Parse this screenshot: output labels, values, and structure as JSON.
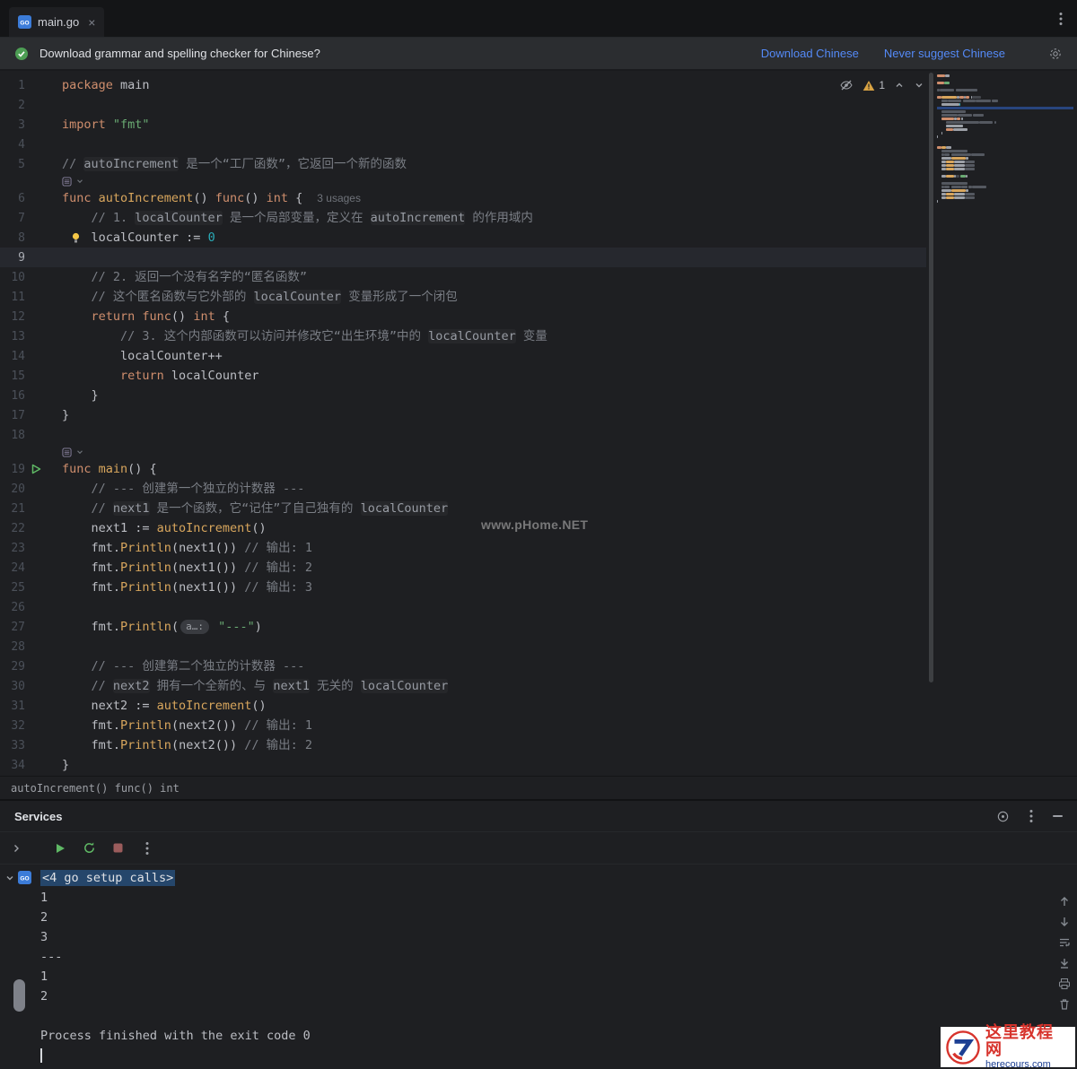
{
  "tab": {
    "label": "main.go",
    "close": "×"
  },
  "banner": {
    "text": "Download grammar and spelling checker for Chinese?",
    "actions": [
      {
        "label": "Download Chinese"
      },
      {
        "label": "Never suggest Chinese"
      }
    ]
  },
  "editor": {
    "inspection_warning_count": "1",
    "rows": [
      {
        "n": 1,
        "segs": [
          [
            "kw",
            "package "
          ],
          [
            "pl",
            "main"
          ]
        ]
      },
      {
        "n": 2,
        "segs": []
      },
      {
        "n": 3,
        "segs": [
          [
            "kw",
            "import "
          ],
          [
            "str",
            "\"fmt\""
          ]
        ]
      },
      {
        "n": 4,
        "segs": []
      },
      {
        "n": 5,
        "segs": [
          [
            "cmt",
            "// "
          ],
          [
            "cmtc",
            "autoIncrement"
          ],
          [
            "cmt",
            " 是一个“工厂函数”，它返回一个新的函数"
          ]
        ]
      },
      {
        "hint": true
      },
      {
        "n": 6,
        "segs": [
          [
            "kw",
            "func "
          ],
          [
            "fn",
            "autoIncrement"
          ],
          [
            "pl",
            "() "
          ],
          [
            "kw",
            "func"
          ],
          [
            "pl",
            "() "
          ],
          [
            "kw",
            "int"
          ],
          [
            "pl",
            " {"
          ],
          [
            "usages",
            "3 usages"
          ]
        ]
      },
      {
        "n": 7,
        "segs": [
          [
            "cmt",
            "    // 1. "
          ],
          [
            "cmtc",
            "localCounter"
          ],
          [
            "cmt",
            " 是一个局部变量，定义在 "
          ],
          [
            "cmtc",
            "autoIncrement"
          ],
          [
            "cmt",
            " 的作用域内"
          ]
        ]
      },
      {
        "n": 8,
        "bulb": true,
        "segs": [
          [
            "pl",
            "    localCounter := "
          ],
          [
            "num",
            "0"
          ]
        ]
      },
      {
        "n": 9,
        "current": true,
        "segs": []
      },
      {
        "n": 10,
        "segs": [
          [
            "cmt",
            "    // 2. 返回一个没有名字的“匿名函数”"
          ]
        ]
      },
      {
        "n": 11,
        "segs": [
          [
            "cmt",
            "    // 这个匿名函数与它外部的 "
          ],
          [
            "cmtc",
            "localCounter"
          ],
          [
            "cmt",
            " 变量形成了一个闭包"
          ]
        ]
      },
      {
        "n": 12,
        "segs": [
          [
            "kw",
            "    return func"
          ],
          [
            "pl",
            "() "
          ],
          [
            "kw",
            "int"
          ],
          [
            "pl",
            " {"
          ]
        ]
      },
      {
        "n": 13,
        "segs": [
          [
            "cmt",
            "        // 3. 这个内部函数可以访问并修改它“出生环境”中的 "
          ],
          [
            "cmtc",
            "localCounter"
          ],
          [
            "cmt",
            " 变量"
          ]
        ]
      },
      {
        "n": 14,
        "segs": [
          [
            "pl",
            "        localCounter++"
          ]
        ]
      },
      {
        "n": 15,
        "segs": [
          [
            "kw",
            "        return "
          ],
          [
            "pl",
            "localCounter"
          ]
        ]
      },
      {
        "n": 16,
        "segs": [
          [
            "pl",
            "    }"
          ]
        ]
      },
      {
        "n": 17,
        "segs": [
          [
            "pl",
            "}"
          ]
        ]
      },
      {
        "n": 18,
        "segs": []
      },
      {
        "hint": true
      },
      {
        "n": 19,
        "run": true,
        "segs": [
          [
            "kw",
            "func "
          ],
          [
            "fn",
            "main"
          ],
          [
            "pl",
            "() {"
          ]
        ]
      },
      {
        "n": 20,
        "segs": [
          [
            "cmt",
            "    // --- 创建第一个独立的计数器 ---"
          ]
        ]
      },
      {
        "n": 21,
        "segs": [
          [
            "cmt",
            "    // "
          ],
          [
            "cmtc",
            "next1"
          ],
          [
            "cmt",
            " 是一个函数，它“记住”了自己独有的 "
          ],
          [
            "cmtc",
            "localCounter"
          ]
        ]
      },
      {
        "n": 22,
        "segs": [
          [
            "pl",
            "    next1 := "
          ],
          [
            "fn",
            "autoIncrement"
          ],
          [
            "pl",
            "()"
          ]
        ]
      },
      {
        "n": 23,
        "segs": [
          [
            "pl",
            "    fmt."
          ],
          [
            "fn",
            "Println"
          ],
          [
            "pl",
            "(next1()) "
          ],
          [
            "cmt",
            "// 输出: 1"
          ]
        ]
      },
      {
        "n": 24,
        "segs": [
          [
            "pl",
            "    fmt."
          ],
          [
            "fn",
            "Println"
          ],
          [
            "pl",
            "(next1()) "
          ],
          [
            "cmt",
            "// 输出: 2"
          ]
        ]
      },
      {
        "n": 25,
        "segs": [
          [
            "pl",
            "    fmt."
          ],
          [
            "fn",
            "Println"
          ],
          [
            "pl",
            "(next1()) "
          ],
          [
            "cmt",
            "// 输出: 3"
          ]
        ]
      },
      {
        "n": 26,
        "segs": []
      },
      {
        "n": 27,
        "segs": [
          [
            "pl",
            "    fmt."
          ],
          [
            "fn",
            "Println"
          ],
          [
            "pl",
            "("
          ],
          [
            "inlay",
            "a…:"
          ],
          [
            "str",
            " \"---\""
          ],
          [
            "pl",
            ")"
          ]
        ]
      },
      {
        "n": 28,
        "segs": []
      },
      {
        "n": 29,
        "segs": [
          [
            "cmt",
            "    // --- 创建第二个独立的计数器 ---"
          ]
        ]
      },
      {
        "n": 30,
        "segs": [
          [
            "cmt",
            "    // "
          ],
          [
            "cmtc",
            "next2"
          ],
          [
            "cmt",
            " 拥有一个全新的、与 "
          ],
          [
            "cmtc",
            "next1"
          ],
          [
            "cmt",
            " 无关的 "
          ],
          [
            "cmtc",
            "localCounter"
          ]
        ]
      },
      {
        "n": 31,
        "segs": [
          [
            "pl",
            "    next2 := "
          ],
          [
            "fn",
            "autoIncrement"
          ],
          [
            "pl",
            "()"
          ]
        ]
      },
      {
        "n": 32,
        "segs": [
          [
            "pl",
            "    fmt."
          ],
          [
            "fn",
            "Println"
          ],
          [
            "pl",
            "(next2()) "
          ],
          [
            "cmt",
            "// 输出: 1"
          ]
        ]
      },
      {
        "n": 33,
        "segs": [
          [
            "pl",
            "    fmt."
          ],
          [
            "fn",
            "Println"
          ],
          [
            "pl",
            "(next2()) "
          ],
          [
            "cmt",
            "// 输出: 2"
          ]
        ]
      },
      {
        "n": 34,
        "segs": [
          [
            "pl",
            "}"
          ]
        ]
      }
    ]
  },
  "breadcrumb": "autoIncrement() func() int",
  "services": {
    "title": "Services",
    "console": {
      "lines": [
        {
          "t": "<4 go setup calls>",
          "sel": true
        },
        {
          "t": "1"
        },
        {
          "t": "2"
        },
        {
          "t": "3"
        },
        {
          "t": "---"
        },
        {
          "t": "1"
        },
        {
          "t": "2"
        },
        {
          "t": ""
        },
        {
          "t": "Process finished with the exit code 0"
        },
        {
          "t": "",
          "caret": true
        }
      ]
    }
  },
  "watermark": {
    "center": "www.pHome.NET",
    "logo_title": "这里教程网",
    "logo_sub": "herecours.com"
  },
  "colors": {
    "accent_link": "#548AF7",
    "keyword": "#CF8E6D",
    "function": "#D8A65D",
    "string": "#6AAB73",
    "number": "#2AACB8",
    "comment": "#7A7E85",
    "run_green": "#5FB865",
    "warning_yellow": "#D9A343"
  }
}
